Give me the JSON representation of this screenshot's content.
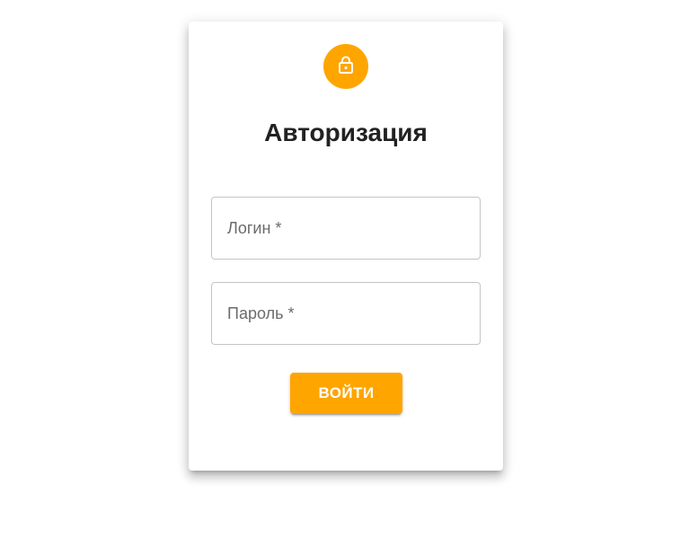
{
  "login_form": {
    "icon": "lock-icon",
    "title": "Авторизация",
    "login_field": {
      "label": "Логин *",
      "value": ""
    },
    "password_field": {
      "label": "Пароль *",
      "value": ""
    },
    "submit_label": "ВОЙТИ"
  },
  "colors": {
    "accent": "#ffa500",
    "title_text": "#212121",
    "field_border": "#c4c4c4",
    "label_text": "#6b6b6b",
    "background": "#ffffff"
  }
}
